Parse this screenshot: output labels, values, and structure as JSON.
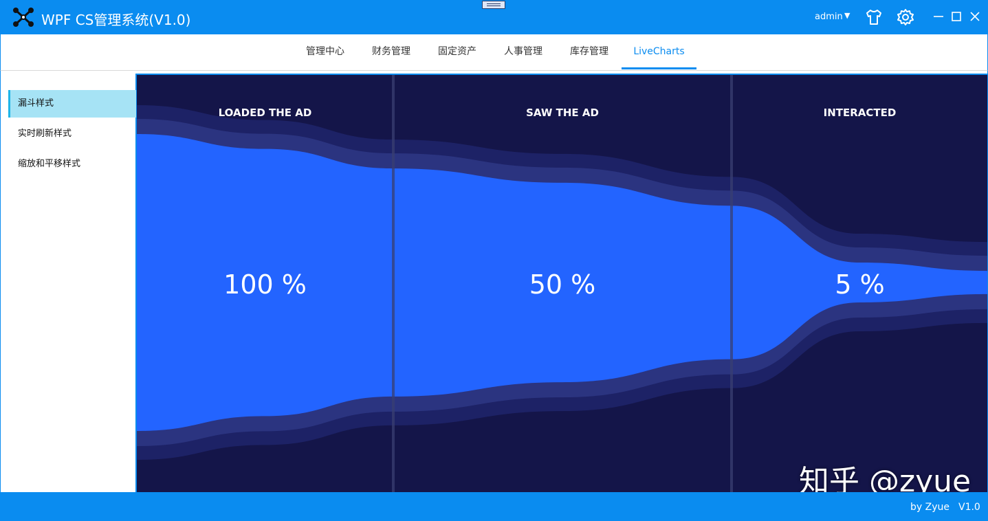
{
  "window": {
    "title": "WPF CS管理系统(V1.0)",
    "user": "admin",
    "icons": [
      "app-logo-icon",
      "shirt-icon",
      "gear-icon",
      "minimize-icon",
      "maximize-icon",
      "close-icon"
    ]
  },
  "nav": {
    "tabs": [
      {
        "label": "管理中心"
      },
      {
        "label": "财务管理"
      },
      {
        "label": "固定资产"
      },
      {
        "label": "人事管理"
      },
      {
        "label": "库存管理"
      },
      {
        "label": "LiveCharts"
      }
    ],
    "active": "LiveCharts"
  },
  "sidebar": {
    "items": [
      {
        "label": "漏斗样式"
      },
      {
        "label": "实时刷新样式"
      },
      {
        "label": "缩放和平移样式"
      }
    ],
    "active": "漏斗样式"
  },
  "chart_data": {
    "type": "area",
    "subtype": "funnel",
    "categories": [
      "LOADED THE AD",
      "SAW THE AD",
      "INTERACTED"
    ],
    "values": [
      100,
      50,
      5
    ],
    "value_labels": [
      "100 %",
      "50 %",
      "5 %"
    ],
    "colors": {
      "background": "#141549",
      "fill": "#2364ff",
      "halo1": "#2b3480",
      "halo2": "#1d2266",
      "divider": "#3a3f72"
    }
  },
  "watermark": "知乎 @zyue",
  "footer": {
    "author": "by Zyue",
    "version": "V1.0"
  },
  "colors": {
    "accent": "#0a8cf0",
    "sidebar_active": "#a6e3f5"
  }
}
